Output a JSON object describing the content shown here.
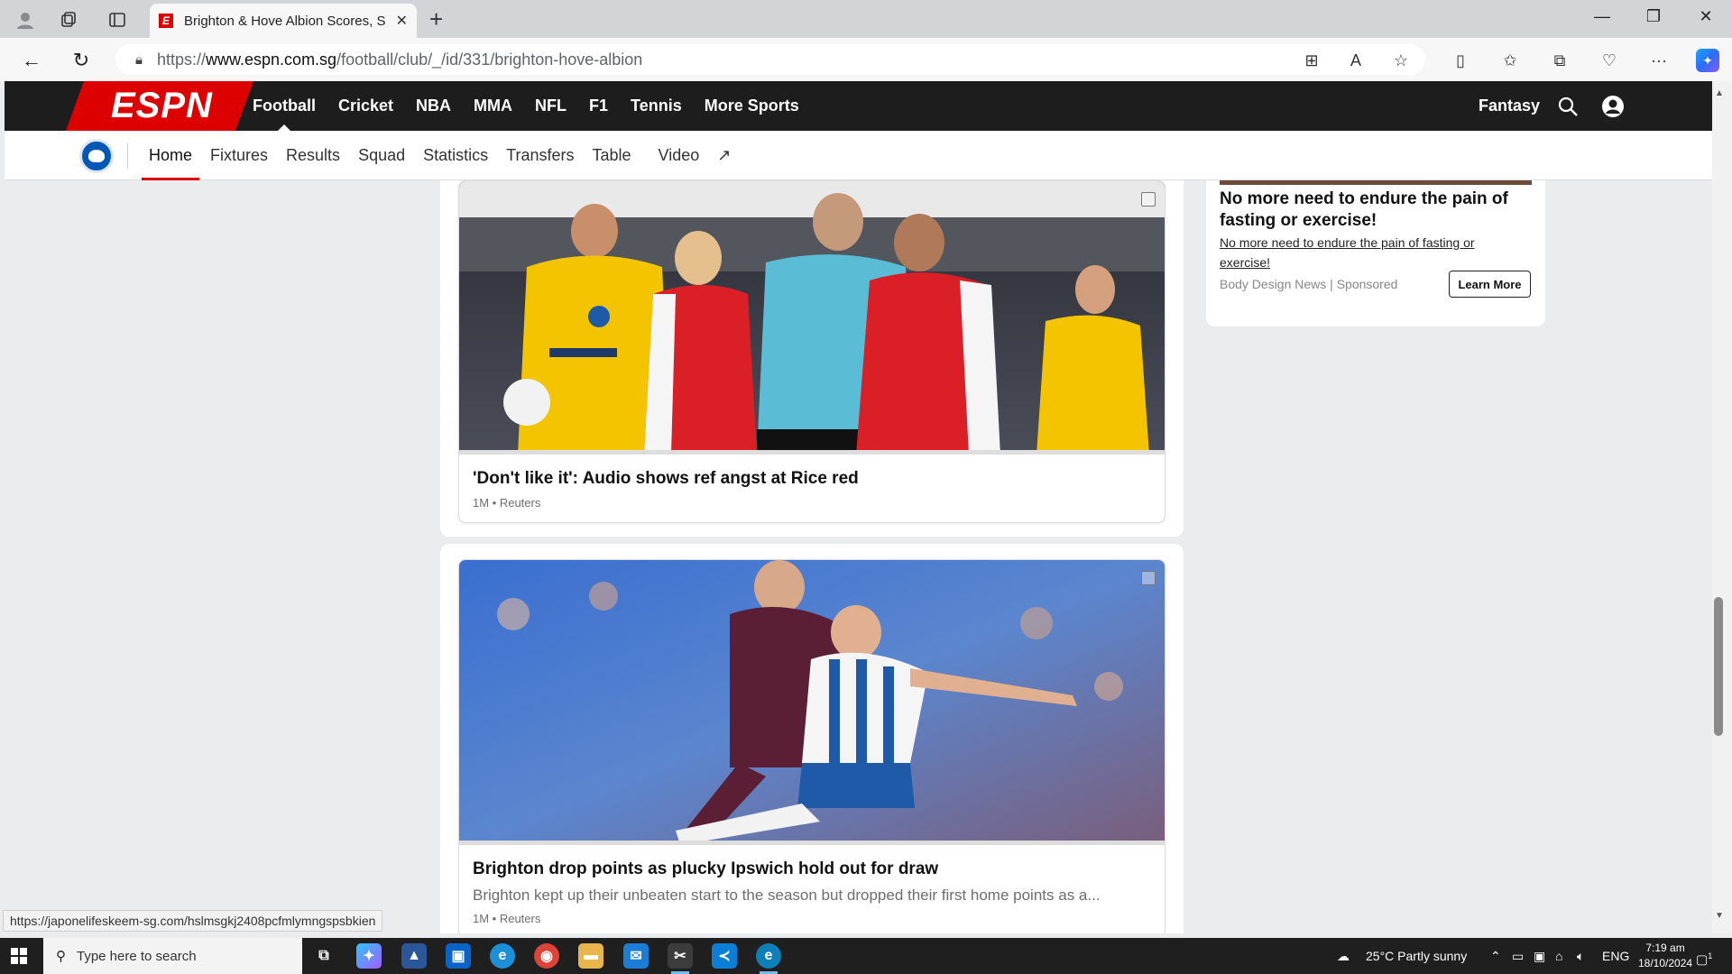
{
  "browser": {
    "tab_title": "Brighton & Hove Albion Scores, S",
    "url_prefix": "https://",
    "url_domain": "www.espn.com.sg",
    "url_path": "/football/club/_/id/331/brighton-hove-albion"
  },
  "espn": {
    "logo": "ESPN",
    "nav": [
      "Football",
      "Cricket",
      "NBA",
      "MMA",
      "NFL",
      "F1",
      "Tennis",
      "More Sports"
    ],
    "fantasy": "Fantasy"
  },
  "club_nav": {
    "items": [
      "Home",
      "Fixtures",
      "Results",
      "Squad",
      "Statistics",
      "Transfers",
      "Table",
      "Video"
    ],
    "active": "Home"
  },
  "articles": [
    {
      "title": "'Don't like it': Audio shows ref angst at Rice red",
      "meta": "1M • Reuters",
      "description": ""
    },
    {
      "title": "Brighton drop points as plucky Ipswich hold out for draw",
      "description": "Brighton kept up their unbeaten start to the season but dropped their first home points as a...",
      "meta": "1M • Reuters"
    }
  ],
  "ad": {
    "title": "No more need to endure the pain of fasting or exercise!",
    "description": "No more need to endure the pain of fasting or exercise!",
    "source": "Body Design News | Sponsored",
    "cta": "Learn More"
  },
  "status_bar_url": "https://japonelifeskeem-sg.com/hslmsgkj2408pcfmlymngspsbkien",
  "taskbar": {
    "search_placeholder": "Type here to search",
    "weather": "25°C  Partly sunny",
    "lang": "ENG",
    "time": "7:19 am",
    "date": "18/10/2024",
    "notifications": "1"
  },
  "colors": {
    "espn_red": "#d00000",
    "header_bg": "#1d1d1e",
    "brighton_blue": "#0057b8"
  }
}
